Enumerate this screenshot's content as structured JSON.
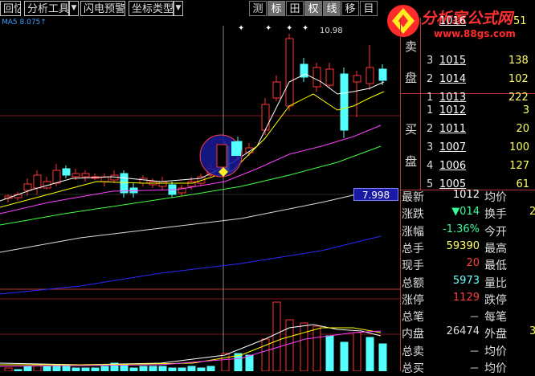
{
  "toolbar": {
    "recall": "回忆",
    "analysis_tools": "分析工具",
    "flash_alert": "闪电预警",
    "coord_type": "坐标类型",
    "tools": [
      {
        "label": "测",
        "active": false
      },
      {
        "label": "标",
        "active": true
      },
      {
        "label": "田",
        "active": false
      },
      {
        "label": "权",
        "active": true
      },
      {
        "label": "线",
        "active": true
      },
      {
        "label": "移",
        "active": false
      },
      {
        "label": "目",
        "active": false
      }
    ]
  },
  "logo": {
    "title": "分析家公式网",
    "url": "www.88gs.com"
  },
  "ma_label": "MA5  8.075↑",
  "high_label": "10.98",
  "price_tag": "7.998",
  "order_book": {
    "sell_label_top": "卖",
    "sell_label_bottom": "盘",
    "buy_label_top": "买",
    "buy_label_bottom": "盘",
    "sell": [
      {
        "level": "3",
        "price": "1015",
        "volume": "138"
      },
      {
        "level": "2",
        "price": "1014",
        "volume": "102"
      },
      {
        "level": "1",
        "price": "1013",
        "volume": "222"
      }
    ],
    "sell_partial": {
      "price": "1016",
      "volume": "51"
    },
    "buy": [
      {
        "level": "1",
        "price": "1012",
        "volume": "3"
      },
      {
        "level": "2",
        "price": "1011",
        "volume": "20"
      },
      {
        "level": "3",
        "price": "1007",
        "volume": "100"
      },
      {
        "level": "4",
        "price": "1006",
        "volume": "127"
      },
      {
        "level": "5",
        "price": "1005",
        "volume": "61"
      }
    ]
  },
  "quote": [
    {
      "label": "最新",
      "value": "1012",
      "label2": "均价",
      "value2": "",
      "vcolor": "#ffffff"
    },
    {
      "label": "涨跌",
      "value": "▼014",
      "label2": "换手",
      "value2": "2",
      "vcolor": "#33ff99"
    },
    {
      "label": "涨幅",
      "value": "-1.36%",
      "label2": "今开",
      "value2": "",
      "vcolor": "#33ff99"
    },
    {
      "label": "总手",
      "value": "59390",
      "label2": "最高",
      "value2": "",
      "vcolor": "#ffff66"
    },
    {
      "label": "现手",
      "value": "20",
      "label2": "最低",
      "value2": "",
      "vcolor": "#ff4040"
    },
    {
      "label": "总额",
      "value": "5973",
      "label2": "量比",
      "value2": "",
      "vcolor": "#66ffff"
    },
    {
      "label": "涨停",
      "value": "1129",
      "label2": "跌停",
      "value2": "",
      "vcolor": "#ff4040"
    },
    {
      "label": "总笔",
      "value": "－",
      "label2": "每笔",
      "value2": "",
      "vcolor": "#dddddd"
    },
    {
      "label": "内盘",
      "value": "26474",
      "label2": "外盘",
      "value2": "3",
      "vcolor": "#dddddd"
    },
    {
      "label": "总卖",
      "value": "－",
      "label2": "均价",
      "value2": "",
      "vcolor": "#dddddd"
    },
    {
      "label": "总买",
      "value": "－",
      "label2": "均价",
      "value2": "",
      "vcolor": "#dddddd"
    }
  ],
  "colors": {
    "up": "#ff3232",
    "down": "#54ffff",
    "ma5": "#ffffff",
    "ma10": "#ffff00",
    "ma20": "#ff40ff",
    "ma30": "#40ff40",
    "ma60": "#dddddd",
    "ma120": "#2a2aff"
  }
}
